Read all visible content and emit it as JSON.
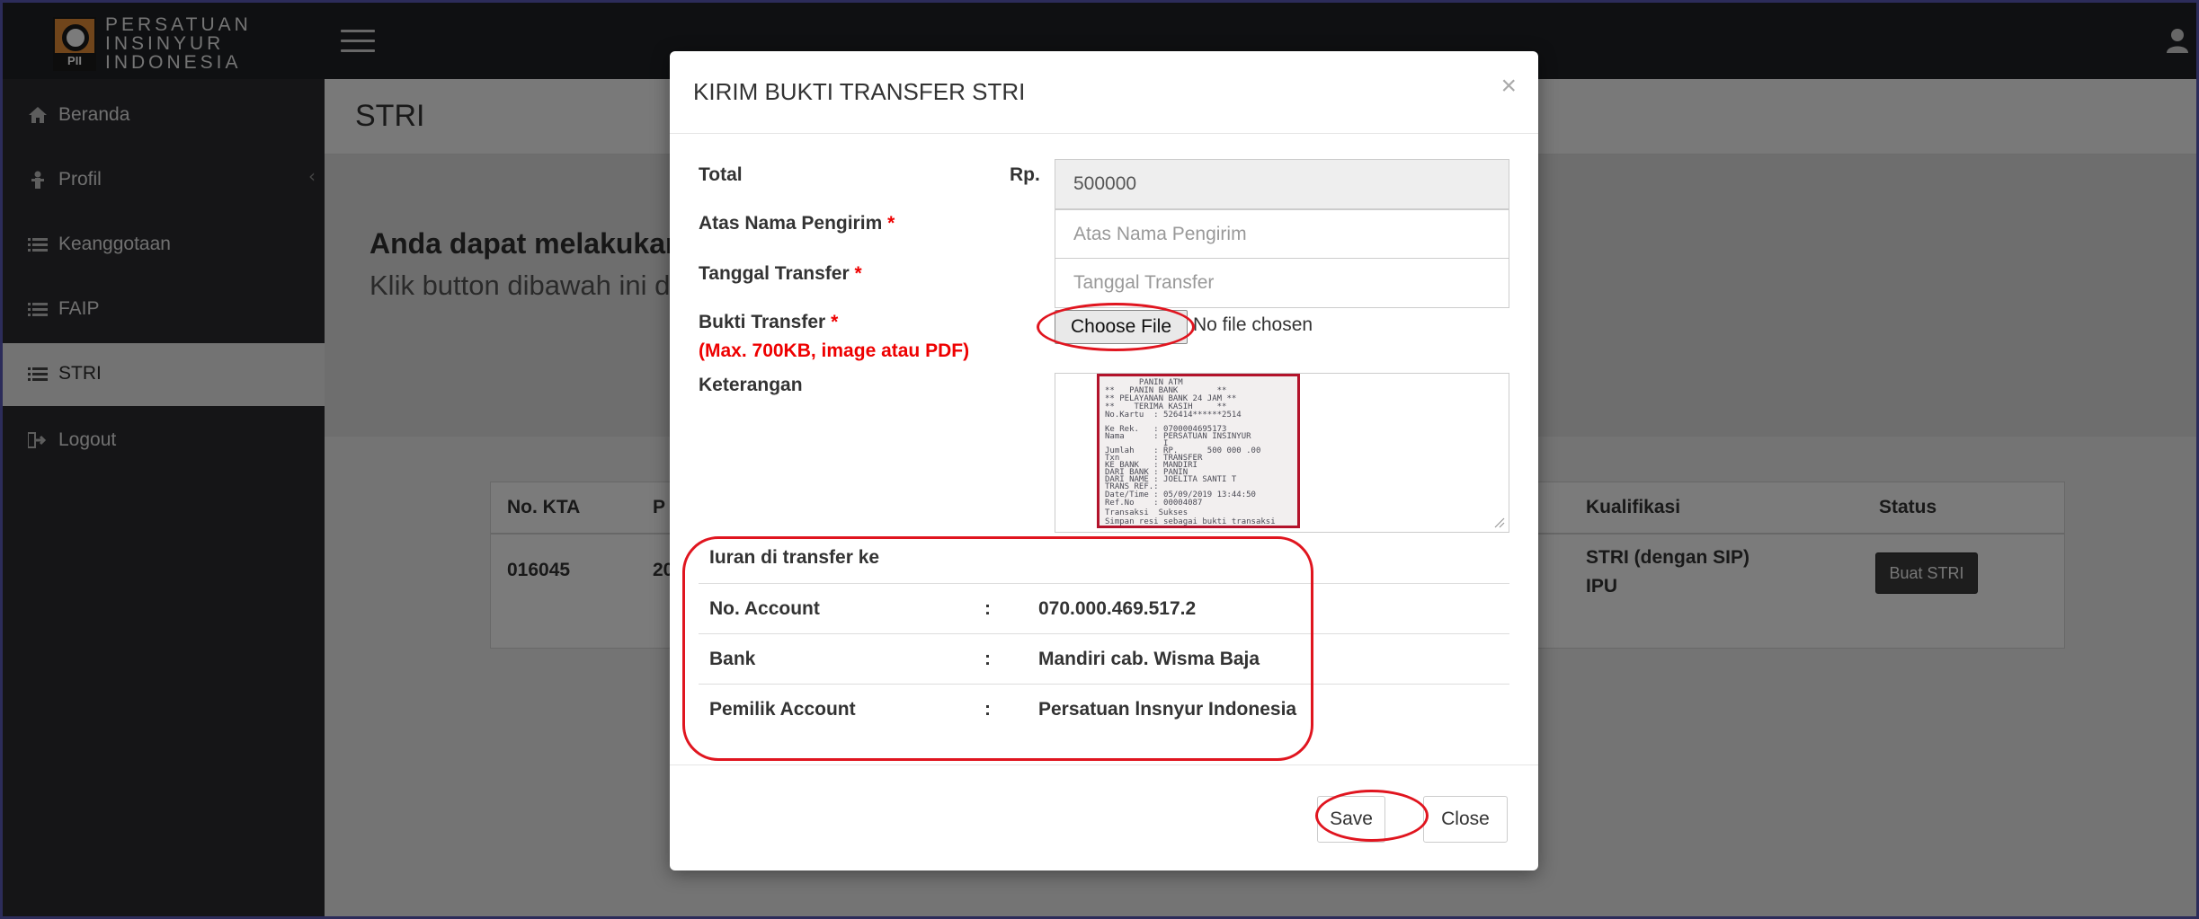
{
  "header": {
    "logo_lines": [
      "PERSATUAN",
      "INSINYUR",
      "INDONESIA"
    ],
    "logo_mark_text": "PII"
  },
  "sidebar": {
    "items": [
      {
        "label": "Beranda",
        "icon": "home-icon"
      },
      {
        "label": "Profil",
        "icon": "user-icon"
      },
      {
        "label": "Keanggotaan",
        "icon": "list-icon"
      },
      {
        "label": "FAIP",
        "icon": "list-icon"
      },
      {
        "label": "STRI",
        "icon": "list-icon",
        "active": true
      },
      {
        "label": "Logout",
        "icon": "logout-icon"
      }
    ]
  },
  "main": {
    "page_title": "STRI",
    "hero_heading": "Anda dapat melakukan",
    "hero_sub": "Klik button dibawah ini d",
    "table": {
      "headers": [
        "No. KTA",
        "P",
        "Kualifikasi",
        "Status"
      ],
      "row": {
        "no_kta": "016045",
        "col2": "20",
        "kualifikasi_1": "STRI (dengan SIP)",
        "kualifikasi_2": "IPU",
        "status_button": "Buat STRI"
      }
    }
  },
  "modal": {
    "title": "KIRIM BUKTI TRANSFER STRI",
    "close_symbol": "×",
    "fields": {
      "total_label": "Total",
      "currency": "Rp.",
      "total_value": "500000",
      "atas_nama_label": "Atas Nama Pengirim",
      "atas_nama_placeholder": "Atas Nama Pengirim",
      "tanggal_label": "Tanggal Transfer",
      "tanggal_placeholder": "Tanggal Transfer",
      "bukti_label": "Bukti Transfer",
      "bukti_note": "(Max. 700KB, image atau PDF)",
      "choose_file": "Choose File",
      "no_file": "No file chosen",
      "keterangan_label": "Keterangan",
      "required_mark": "*"
    },
    "receipt_lines": [
      "       PANIN ATM",
      "**   PANIN BANK        **",
      "** PELAYANAN BANK 24 JAM **",
      "**    TERIMA KASIH     **",
      "No.Kartu  : 526414******2514",
      "",
      "Ke Rek.   : 0700004695173",
      "Nama      : PERSATUAN INSINYUR",
      "            I",
      "Jumlah    : RP.      500 000 .00",
      "Txn       : TRANSFER",
      "KE BANK   : MANDIRI",
      "DARI BANK : PANIN",
      "DARI NAME : JOELITA SANTI T",
      "TRANS REF.:",
      "Date/Time : 05/09/2019 13:44:50",
      "Ref.No    : 00004087",
      "Transaksi  Sukses",
      "Simpan resi sebagai bukti transaksi"
    ],
    "iuran": {
      "title": "Iuran di transfer ke",
      "rows": [
        {
          "key": "No. Account",
          "sep": ":",
          "value": "070.000.469.517.2"
        },
        {
          "key": "Bank",
          "sep": ":",
          "value": "Mandiri cab. Wisma Baja"
        },
        {
          "key": "Pemilik Account",
          "sep": ":",
          "value": "Persatuan lnsnyur Indonesia"
        }
      ]
    },
    "footer": {
      "save": "Save",
      "close": "Close"
    }
  },
  "colors": {
    "annotation_red": "#e0151f",
    "sidebar_bg": "#2a2b2f",
    "header_bg": "#1f2125",
    "required_red": "#e00000"
  }
}
